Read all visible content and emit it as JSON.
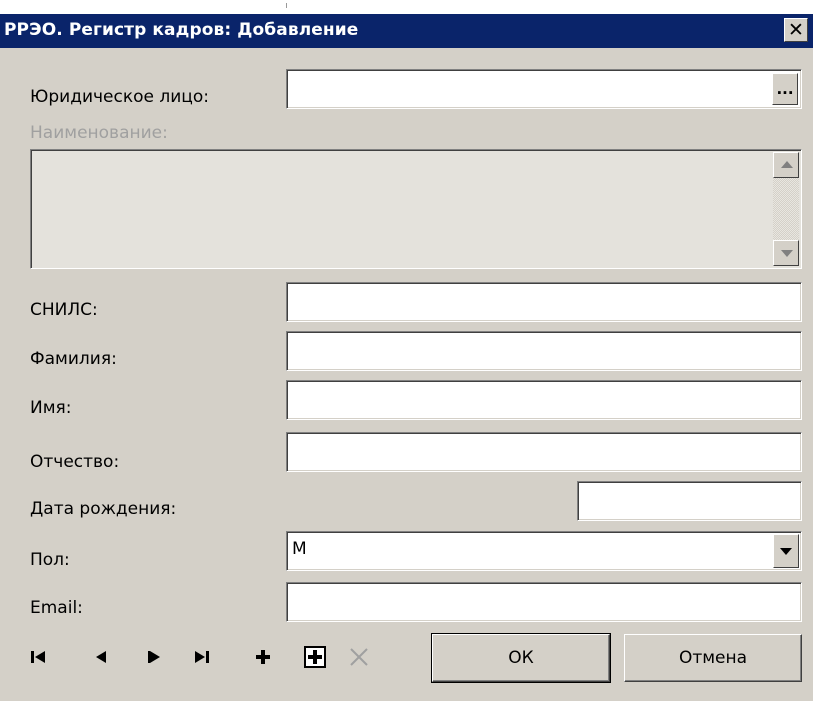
{
  "window": {
    "title": "РРЭО. Регистр кадров: Добавление",
    "close_glyph": "✕"
  },
  "form": {
    "legal_entity": {
      "label": "Юридическое лицо:",
      "value": "",
      "lookup_label": "..."
    },
    "name": {
      "label": "Наименование:",
      "value": ""
    },
    "snils": {
      "label": "СНИЛС:",
      "value": ""
    },
    "last_name": {
      "label": "Фамилия:",
      "value": ""
    },
    "first_name": {
      "label": "Имя:",
      "value": ""
    },
    "patronymic": {
      "label": "Отчество:",
      "value": ""
    },
    "birth_date": {
      "label": "Дата рождения:",
      "value": ""
    },
    "gender": {
      "label": "Пол:",
      "value": "М"
    },
    "email": {
      "label": "Email:",
      "value": ""
    }
  },
  "navigator": {
    "icons": [
      "first-record-icon",
      "prior-record-icon",
      "next-record-icon",
      "last-record-icon",
      "insert-record-icon",
      "append-record-icon",
      "delete-record-icon"
    ]
  },
  "buttons": {
    "ok_label": "ОК",
    "cancel_label": "Отмена"
  },
  "colors": {
    "titlebar": "#0a246a",
    "dialog_bg": "#d4d0c8",
    "disabled_text": "#a0a0a0"
  }
}
